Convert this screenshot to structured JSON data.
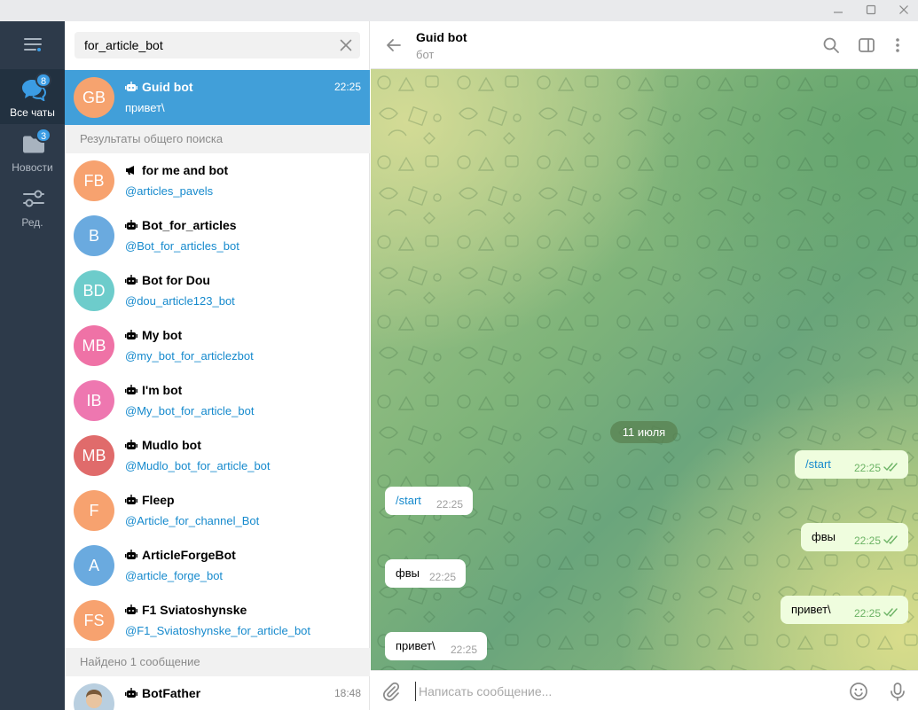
{
  "window": {
    "min_icon": "minimize-icon",
    "max_icon": "maximize-icon",
    "close_icon": "close-icon"
  },
  "rail": {
    "menu_icon": "hamburger-icon",
    "items": [
      {
        "label": "Все чаты",
        "badge": "8",
        "icon": "chats-icon",
        "active": true
      },
      {
        "label": "Новости",
        "badge": "3",
        "icon": "folder-icon",
        "active": false
      },
      {
        "label": "Ред.",
        "badge": "",
        "icon": "sliders-icon",
        "active": false
      }
    ]
  },
  "search": {
    "value": "for_article_bot"
  },
  "top_chat": {
    "initials": "GB",
    "name": "Guid bot",
    "preview": "привет\\",
    "time": "22:25",
    "color": "#f6a36f"
  },
  "section_global": "Результаты общего поиска",
  "results": [
    {
      "initials": "FB",
      "name": "for me and bot",
      "username": "@articles_pavels",
      "color": "#f7a26f",
      "kind": "channel"
    },
    {
      "initials": "B",
      "name": "Bot_for_articles",
      "username": "@Bot_for_articles_bot",
      "color": "#6aaadf",
      "kind": "bot"
    },
    {
      "initials": "BD",
      "name": "Bot for Dou",
      "username": "@dou_article123_bot",
      "color": "#6dcccb",
      "kind": "bot"
    },
    {
      "initials": "MB",
      "name": "My bot",
      "username": "@my_bot_for_articlezbot",
      "color": "#ef72a6",
      "kind": "bot"
    },
    {
      "initials": "IB",
      "name": "I'm bot",
      "username": "@My_bot_for_article_bot",
      "color": "#ee77b0",
      "kind": "bot"
    },
    {
      "initials": "MB",
      "name": "Mudlo bot",
      "username": "@Mudlo_bot_for_article_bot",
      "color": "#e06b6b",
      "kind": "bot"
    },
    {
      "initials": "F",
      "name": "Fleep",
      "username": "@Article_for_channel_Bot",
      "color": "#f7a26f",
      "kind": "bot"
    },
    {
      "initials": "A",
      "name": "ArticleForgeBot",
      "username": "@article_forge_bot",
      "color": "#6aaadf",
      "kind": "bot"
    },
    {
      "initials": "FS",
      "name": "F1 Sviatoshynske",
      "username": "@F1_Sviatoshynske_for_article_bot",
      "color": "#f7a26f",
      "kind": "bot"
    }
  ],
  "section_messages": "Найдено 1 сообщение",
  "message_result": {
    "name": "BotFather",
    "time": "18:48"
  },
  "chat": {
    "title": "Guid bot",
    "status": "бот",
    "date": "11 июля",
    "messages": [
      {
        "dir": "out",
        "text": "/start",
        "time": "22:25"
      },
      {
        "dir": "in",
        "text": "/start",
        "time": "22:25"
      },
      {
        "dir": "out",
        "text": "фвы",
        "time": "22:25"
      },
      {
        "dir": "in",
        "text": "фвы",
        "time": "22:25"
      },
      {
        "dir": "out",
        "text": "привет\\",
        "time": "22:25"
      },
      {
        "dir": "in",
        "text": "привет\\",
        "time": "22:25"
      }
    ]
  },
  "composer": {
    "placeholder": "Написать сообщение..."
  }
}
